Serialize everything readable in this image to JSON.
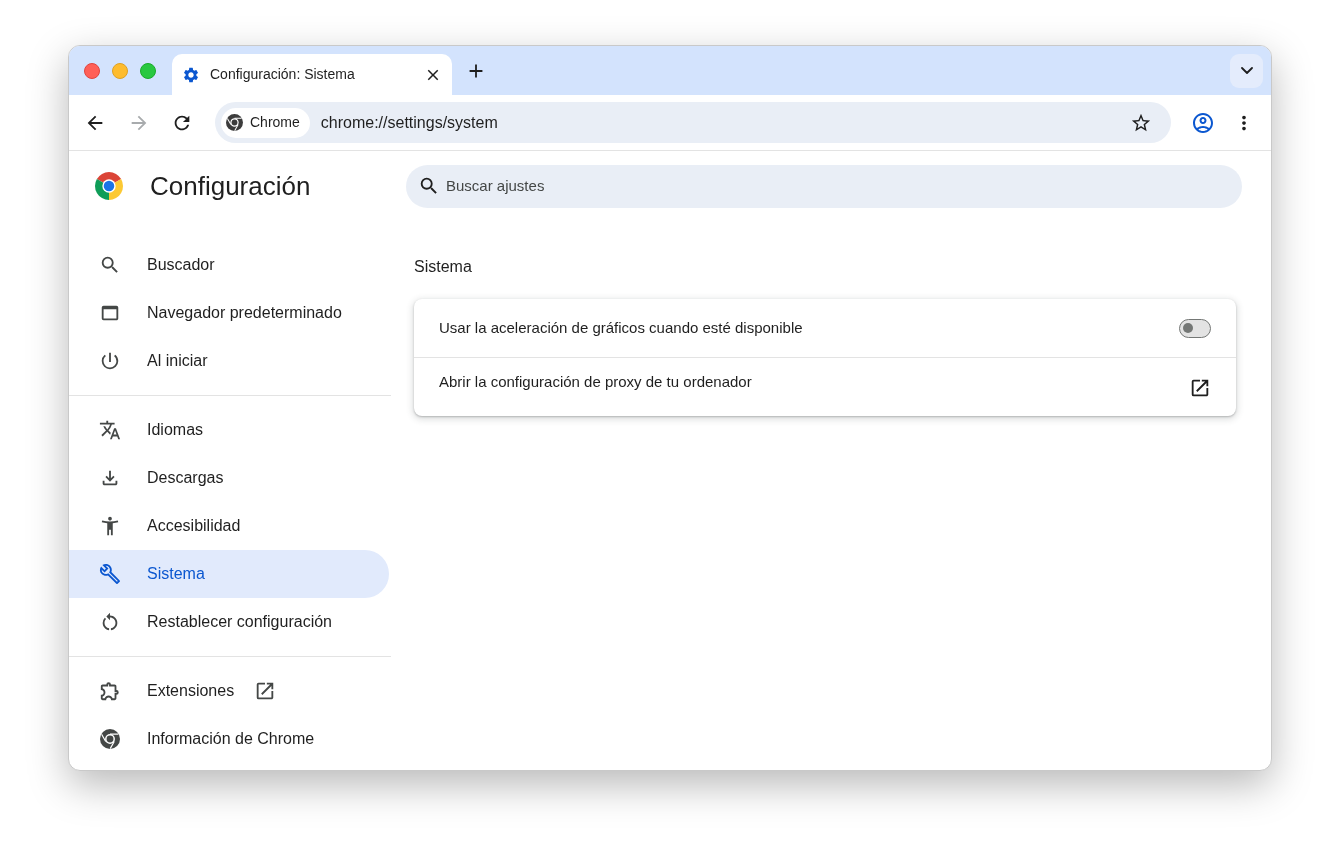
{
  "tabs": [
    {
      "title": "Configuración: Sistema",
      "selected": true
    }
  ],
  "toolbar": {
    "back_disabled": false,
    "forward_disabled": true,
    "site_chip": "Chrome",
    "url": "chrome://settings/system"
  },
  "header": {
    "title": "Configuración",
    "search": {
      "placeholder": "Buscar ajustes"
    }
  },
  "sidebar": {
    "groups": [
      {
        "items": [
          {
            "label": "Buscador",
            "selected": false,
            "external": false
          },
          {
            "label": "Navegador predeterminado",
            "selected": false,
            "external": false
          },
          {
            "label": "Al iniciar",
            "selected": false,
            "external": false
          }
        ]
      },
      {
        "items": [
          {
            "label": "Idiomas",
            "selected": false,
            "external": false
          },
          {
            "label": "Descargas",
            "selected": false,
            "external": false
          },
          {
            "label": "Accesibilidad",
            "selected": false,
            "external": false
          },
          {
            "label": "Sistema",
            "selected": true,
            "external": false
          },
          {
            "label": "Restablecer configuración",
            "selected": false,
            "external": false
          }
        ]
      },
      {
        "items": [
          {
            "label": "Extensiones",
            "selected": false,
            "external": true
          },
          {
            "label": "Información de Chrome",
            "selected": false,
            "external": false
          }
        ]
      }
    ]
  },
  "section": {
    "title": "Sistema",
    "rows": [
      {
        "kind": "toggle",
        "label": "Usar la aceleración de gráficos cuando esté disponible",
        "on": false
      },
      {
        "kind": "link",
        "label": "Abrir la configuración de proxy de tu ordenador"
      }
    ]
  }
}
